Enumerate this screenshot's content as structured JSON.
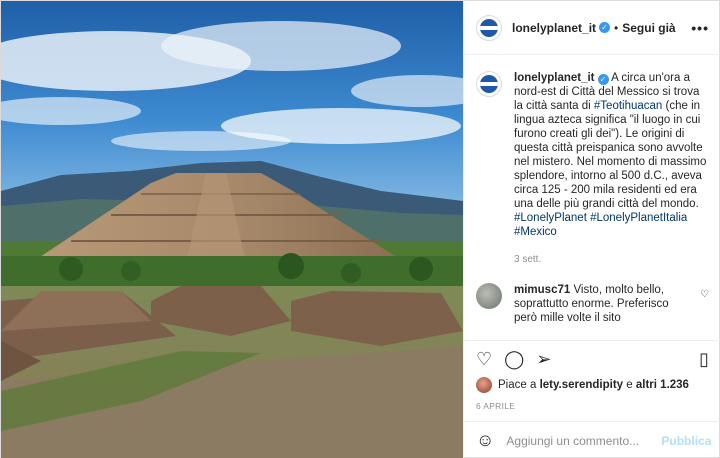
{
  "post": {
    "username": "lonelyplanet_it",
    "follow_label": "Segui già",
    "more_label": "•••",
    "verified_mark": "✓"
  },
  "caption": {
    "username": "lonelyplanet_it",
    "text_1": "A circa un'ora a nord-est di Città del Messico si trova la città santa di ",
    "tag_1": "#Teotihuacan",
    "text_2": " (che in lingua azteca significa \"il luogo in cui furono creati gli dei\"). Le origini di questa città preispanica sono avvolte nel mistero. Nel momento di massimo splendore, intorno al 500 d.C., aveva circa 125 - 200 mila residenti ed era una delle più grandi città del mondo.",
    "tags_end": "#LonelyPlanet #LonelyPlanetItalia #Mexico",
    "time": "3 sett."
  },
  "comment": {
    "username": "mimusc71",
    "text": "Visto, molto bello, soprattutto enorme. Preferisco però mille volte il sito"
  },
  "actions": {
    "like_icon": "heart-icon",
    "comment_icon": "comment-icon",
    "share_icon": "share-icon",
    "save_icon": "bookmark-icon"
  },
  "likes": {
    "prefix": "Piace a ",
    "user": "lety.serendipity",
    "middle": " e ",
    "others": "altri 1.236"
  },
  "date": "6 APRILE",
  "add_comment": {
    "placeholder": "Aggiungi un commento...",
    "publish_label": "Pubblica"
  }
}
